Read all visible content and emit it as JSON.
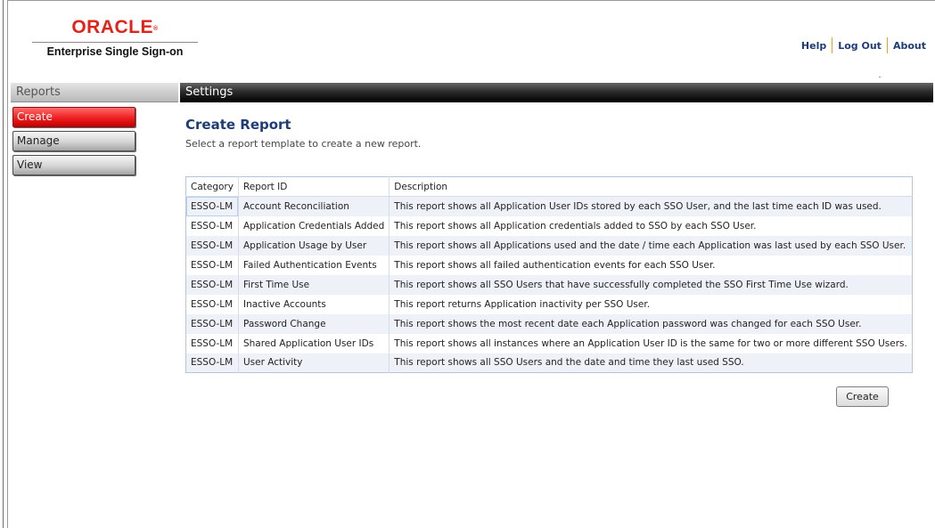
{
  "header": {
    "logo_text": "ORACLE",
    "logo_mark": "®",
    "product_name": "Enterprise Single Sign-on",
    "links": [
      "Help",
      "Log Out",
      "About"
    ]
  },
  "sidebar": {
    "title": "Reports",
    "items": [
      {
        "label": "Create",
        "active": true
      },
      {
        "label": "Manage",
        "active": false
      },
      {
        "label": "View",
        "active": false
      }
    ]
  },
  "main": {
    "bar_title": "Settings",
    "title": "Create Report",
    "subtitle": "Select a report template to create a new report.",
    "table": {
      "columns": [
        "Category",
        "Report ID",
        "Description"
      ],
      "rows": [
        [
          "ESSO-LM",
          "Account Reconciliation",
          "This report shows all Application User IDs stored by each SSO User, and the last time each ID was used."
        ],
        [
          "ESSO-LM",
          "Application Credentials Added",
          "This report shows all Application credentials added to SSO by each SSO User."
        ],
        [
          "ESSO-LM",
          "Application Usage by User",
          "This report shows all Applications used and the date / time each Application was last used by each SSO User."
        ],
        [
          "ESSO-LM",
          "Failed Authentication Events",
          "This report shows all failed authentication events for each SSO User."
        ],
        [
          "ESSO-LM",
          "First Time Use",
          "This report shows all SSO Users that have successfully completed the SSO First Time Use wizard."
        ],
        [
          "ESSO-LM",
          "Inactive Accounts",
          "This report returns Application inactivity per SSO User."
        ],
        [
          "ESSO-LM",
          "Password Change",
          "This report shows the most recent date each Application password was changed for each SSO User."
        ],
        [
          "ESSO-LM",
          "Shared Application User IDs",
          "This report shows all instances where an Application User ID is the same for two or more different SSO Users."
        ],
        [
          "ESSO-LM",
          "User Activity",
          "This report shows all SSO Users and the date and time they last used SSO."
        ]
      ]
    },
    "create_button": "Create"
  },
  "colors": {
    "brand_red": "#e2231a",
    "title_blue": "#1f3c78",
    "link_separator": "#e8a31a",
    "row_alt": "#eef2f8"
  }
}
